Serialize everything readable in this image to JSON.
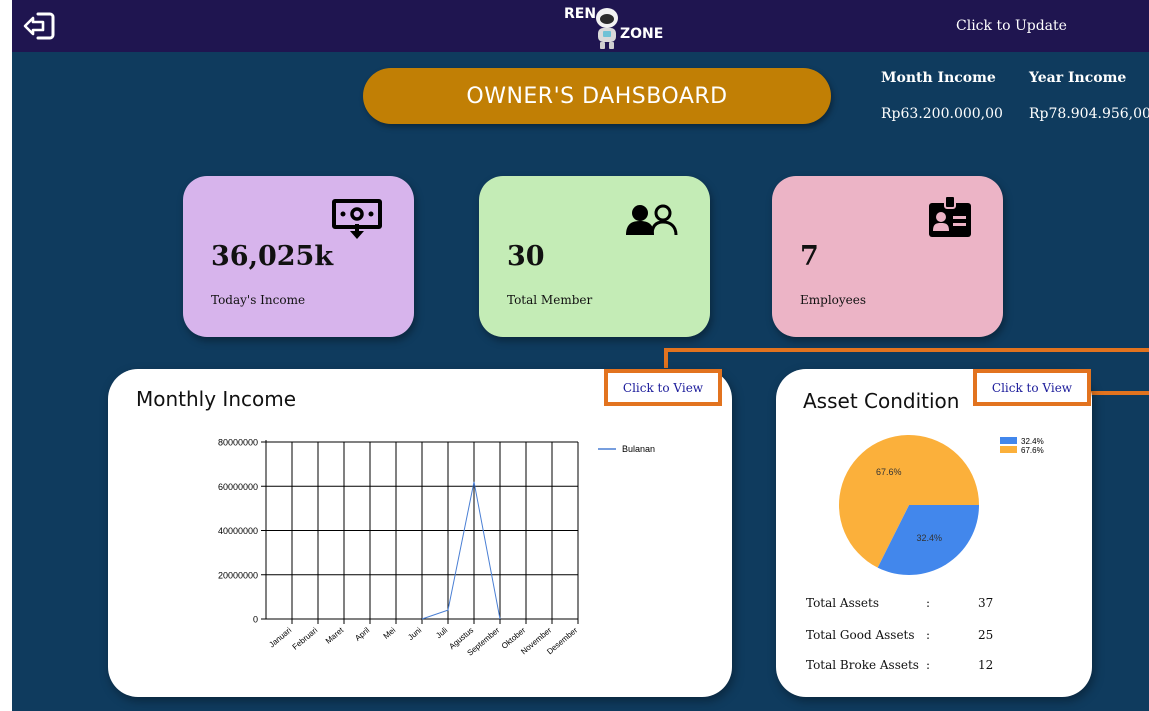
{
  "header": {
    "logo_top": "REN",
    "logo_bottom": "ZONE",
    "update_label": "Click to Update"
  },
  "dashboard": {
    "title": "OWNER'S DAHSBOARD"
  },
  "income_summary": {
    "month_label": "Month Income",
    "month_value": "Rp63.200.000,00",
    "year_label": "Year Income",
    "year_value": "Rp78.904.956,00"
  },
  "cards": {
    "income": {
      "value": "36,025k",
      "label": "Today's Income",
      "color": "#d7b4ec",
      "icon": "money-receive-icon"
    },
    "members": {
      "value": "30",
      "label": "Total Member",
      "color": "#c4ecb6",
      "icon": "users-icon"
    },
    "employees": {
      "value": "7",
      "label": "Employees",
      "color": "#ecb4c6",
      "icon": "id-badge-icon"
    }
  },
  "monthly_panel": {
    "title": "Monthly Income",
    "view_label": "Click to View"
  },
  "asset_panel": {
    "title": "Asset Condition",
    "view_label": "Click to View",
    "rows": [
      {
        "label": "Total Assets",
        "sep": ":",
        "value": "37"
      },
      {
        "label": "Total Good Assets",
        "sep": ":",
        "value": "25"
      },
      {
        "label": "Total Broke Assets",
        "sep": ":",
        "value": "12"
      }
    ]
  },
  "chart_data": [
    {
      "type": "line",
      "categories": [
        "Januari",
        "Februari",
        "Maret",
        "April",
        "Mei",
        "Juni",
        "Juli",
        "Agustus",
        "September",
        "Oktober",
        "November",
        "Desember"
      ],
      "series": [
        {
          "name": "Bulanan",
          "values": [
            null,
            null,
            null,
            null,
            null,
            0,
            4000000,
            62000000,
            0,
            null,
            null,
            null
          ],
          "color": "#4a7fd4"
        }
      ],
      "yticks": [
        "0",
        "20000000",
        "40000000",
        "60000000",
        "80000000"
      ],
      "ylim": [
        0,
        80000000
      ],
      "grid": true,
      "legend": "top-right"
    },
    {
      "type": "pie",
      "slices": [
        {
          "label": "32.4%",
          "value": 32.4,
          "color": "#4287ec"
        },
        {
          "label": "67.6%",
          "value": 67.6,
          "color": "#fbb03b"
        }
      ],
      "legend": "top-right"
    }
  ],
  "colors": {
    "background": "#0f3b5e",
    "topbar": "#1f1550",
    "accent": "#c17f05",
    "highlight": "#e2731f"
  }
}
